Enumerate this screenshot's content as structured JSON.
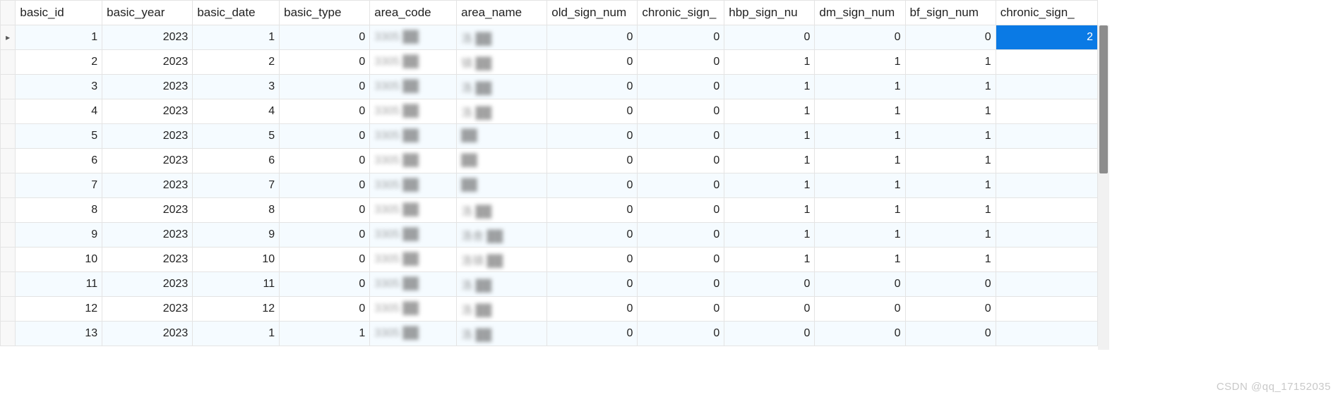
{
  "watermark": "CSDN @qq_17152035",
  "columns": [
    "basic_id",
    "basic_year",
    "basic_date",
    "basic_type",
    "area_code",
    "area_name",
    "old_sign_num",
    "chronic_sign_",
    "hbp_sign_nu",
    "dm_sign_num",
    "bf_sign_num",
    "chronic_sign_"
  ],
  "current_row_marker": "▸",
  "rows": [
    {
      "basic_id": 1,
      "basic_year": 2023,
      "basic_date": 1,
      "basic_type": 0,
      "area_code": "3305",
      "area_name": "洛",
      "old_sign_num": 0,
      "chronic_sign": 0,
      "hbp_sign_nu": 0,
      "dm_sign_num": 0,
      "bf_sign_num": 0,
      "chronic_sign2": 2,
      "selected": true
    },
    {
      "basic_id": 2,
      "basic_year": 2023,
      "basic_date": 2,
      "basic_type": 0,
      "area_code": "3305",
      "area_name": "镇",
      "old_sign_num": 0,
      "chronic_sign": 0,
      "hbp_sign_nu": 1,
      "dm_sign_num": 1,
      "bf_sign_num": 1,
      "chronic_sign2": ""
    },
    {
      "basic_id": 3,
      "basic_year": 2023,
      "basic_date": 3,
      "basic_type": 0,
      "area_code": "3305",
      "area_name": "洛",
      "old_sign_num": 0,
      "chronic_sign": 0,
      "hbp_sign_nu": 1,
      "dm_sign_num": 1,
      "bf_sign_num": 1,
      "chronic_sign2": ""
    },
    {
      "basic_id": 4,
      "basic_year": 2023,
      "basic_date": 4,
      "basic_type": 0,
      "area_code": "3305",
      "area_name": "洛",
      "old_sign_num": 0,
      "chronic_sign": 0,
      "hbp_sign_nu": 1,
      "dm_sign_num": 1,
      "bf_sign_num": 1,
      "chronic_sign2": ""
    },
    {
      "basic_id": 5,
      "basic_year": 2023,
      "basic_date": 5,
      "basic_type": 0,
      "area_code": "3305",
      "area_name": "",
      "old_sign_num": 0,
      "chronic_sign": 0,
      "hbp_sign_nu": 1,
      "dm_sign_num": 1,
      "bf_sign_num": 1,
      "chronic_sign2": ""
    },
    {
      "basic_id": 6,
      "basic_year": 2023,
      "basic_date": 6,
      "basic_type": 0,
      "area_code": "3305",
      "area_name": "",
      "old_sign_num": 0,
      "chronic_sign": 0,
      "hbp_sign_nu": 1,
      "dm_sign_num": 1,
      "bf_sign_num": 1,
      "chronic_sign2": ""
    },
    {
      "basic_id": 7,
      "basic_year": 2023,
      "basic_date": 7,
      "basic_type": 0,
      "area_code": "3305",
      "area_name": "",
      "old_sign_num": 0,
      "chronic_sign": 0,
      "hbp_sign_nu": 1,
      "dm_sign_num": 1,
      "bf_sign_num": 1,
      "chronic_sign2": ""
    },
    {
      "basic_id": 8,
      "basic_year": 2023,
      "basic_date": 8,
      "basic_type": 0,
      "area_code": "3305",
      "area_name": "洛",
      "old_sign_num": 0,
      "chronic_sign": 0,
      "hbp_sign_nu": 1,
      "dm_sign_num": 1,
      "bf_sign_num": 1,
      "chronic_sign2": ""
    },
    {
      "basic_id": 9,
      "basic_year": 2023,
      "basic_date": 9,
      "basic_type": 0,
      "area_code": "3305",
      "area_name": "洛舍",
      "old_sign_num": 0,
      "chronic_sign": 0,
      "hbp_sign_nu": 1,
      "dm_sign_num": 1,
      "bf_sign_num": 1,
      "chronic_sign2": ""
    },
    {
      "basic_id": 10,
      "basic_year": 2023,
      "basic_date": 10,
      "basic_type": 0,
      "area_code": "3305",
      "area_name": "洛镇",
      "old_sign_num": 0,
      "chronic_sign": 0,
      "hbp_sign_nu": 1,
      "dm_sign_num": 1,
      "bf_sign_num": 1,
      "chronic_sign2": ""
    },
    {
      "basic_id": 11,
      "basic_year": 2023,
      "basic_date": 11,
      "basic_type": 0,
      "area_code": "3305",
      "area_name": "洛",
      "old_sign_num": 0,
      "chronic_sign": 0,
      "hbp_sign_nu": 0,
      "dm_sign_num": 0,
      "bf_sign_num": 0,
      "chronic_sign2": ""
    },
    {
      "basic_id": 12,
      "basic_year": 2023,
      "basic_date": 12,
      "basic_type": 0,
      "area_code": "3305",
      "area_name": "洛",
      "old_sign_num": 0,
      "chronic_sign": 0,
      "hbp_sign_nu": 0,
      "dm_sign_num": 0,
      "bf_sign_num": 0,
      "chronic_sign2": ""
    },
    {
      "basic_id": 13,
      "basic_year": 2023,
      "basic_date": 1,
      "basic_type": 1,
      "area_code": "3305",
      "area_name": "洛",
      "old_sign_num": 0,
      "chronic_sign": 0,
      "hbp_sign_nu": 0,
      "dm_sign_num": 0,
      "bf_sign_num": 0,
      "chronic_sign2": ""
    }
  ]
}
